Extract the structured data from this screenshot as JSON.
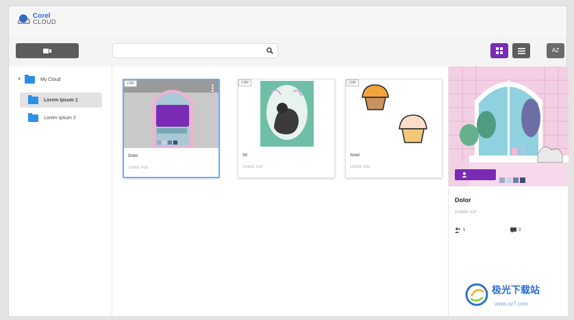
{
  "app": {
    "logo_brand": "Corel",
    "logo_product": "CLOUD"
  },
  "toolbar": {
    "search_placeholder": "",
    "sort_label": "AZ"
  },
  "sidebar": {
    "root": "My Cloud",
    "items": [
      {
        "label": "Lorem Ipsum 1",
        "selected": true
      },
      {
        "label": "Lorem Ipsum 2",
        "selected": false
      }
    ]
  },
  "files": [
    {
      "tag": "CDR",
      "name": "Dolor",
      "date": "12/4/20, 4:05",
      "selected": true
    },
    {
      "tag": "CDR",
      "name": "Sit",
      "date": "12/4/20, 3:52",
      "selected": false
    },
    {
      "tag": "CDR",
      "name": "Amet",
      "date": "12/4/20, 3:50",
      "selected": false
    }
  ],
  "details": {
    "name": "Dolor",
    "date": "11/26/20, 4:27",
    "collaborators": "1",
    "comments": "3"
  },
  "watermark": {
    "text": "极光下载站",
    "url": "www.xz7.com"
  },
  "colors": {
    "accent": "#7a2bb5",
    "folder": "#2d8fe6",
    "selection": "#6aaef0"
  }
}
